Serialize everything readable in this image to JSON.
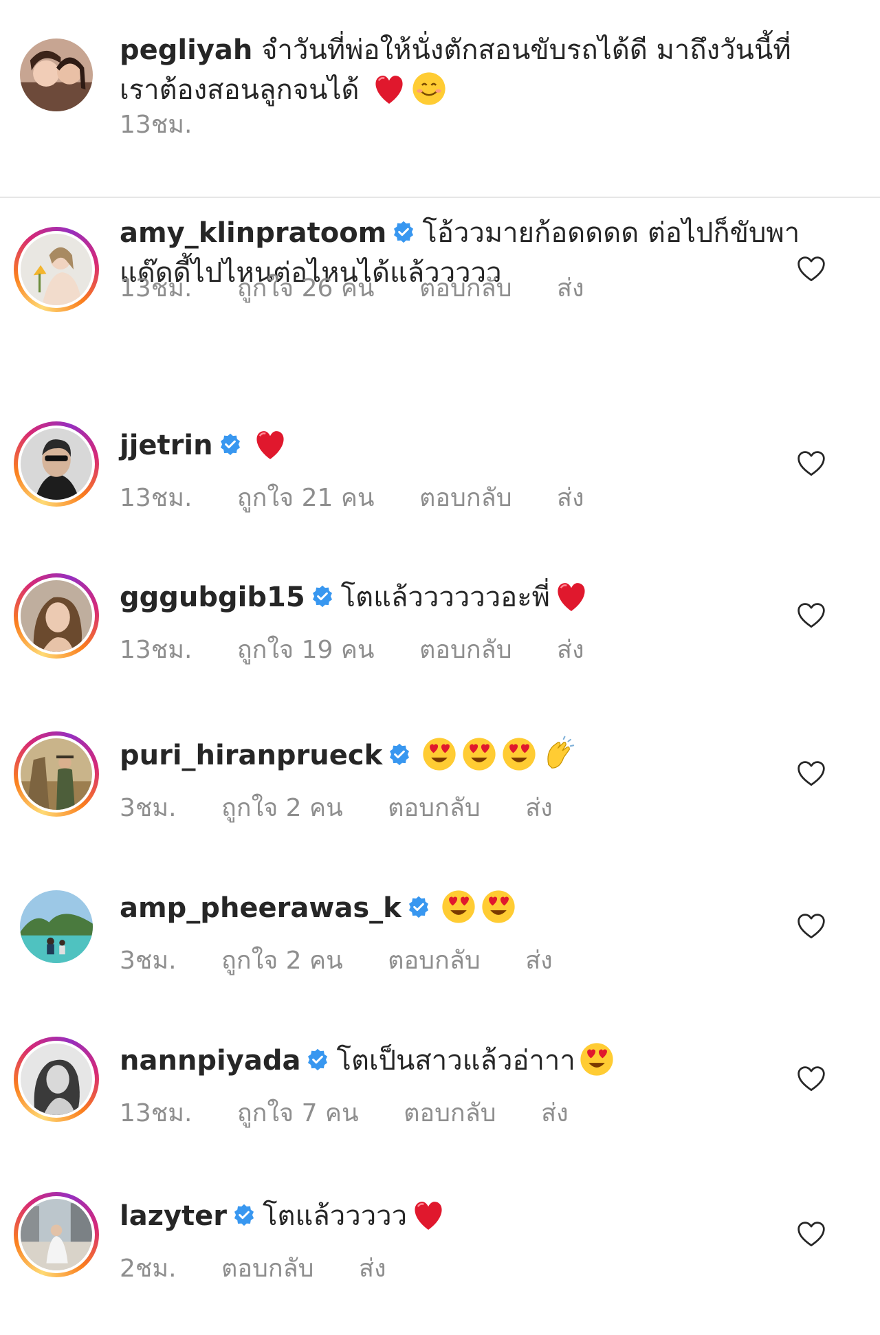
{
  "caption": {
    "username": "pegliyah",
    "text": "จำวันที่พ่อให้นั่งตักสอนขับรถได้ดี มาถึงวันนี้ที่เราต้องสอนลูกจนได้",
    "emojis": [
      "heart",
      "smile"
    ],
    "time": "13ชม."
  },
  "comments": [
    {
      "username": "amy_klinpratoom",
      "verified": true,
      "text": "โอ้ววมายก้อดดดด ต่อไปก็ขับพาแด๊ดดี้ไปไหนต่อไหนได้แล้ววววว",
      "emojis": [],
      "time": "13ชม.",
      "likes": "ถูกใจ 26 คน",
      "reply": "ตอบกลับ",
      "send": "ส่ง"
    },
    {
      "username": "jjetrin",
      "verified": true,
      "text": "",
      "emojis": [
        "heart"
      ],
      "time": "13ชม.",
      "likes": "ถูกใจ 21 คน",
      "reply": "ตอบกลับ",
      "send": "ส่ง"
    },
    {
      "username": "gggubgib15",
      "verified": true,
      "text": "โตแล้ววววววอะพี่",
      "emojis": [
        "heart"
      ],
      "time": "13ชม.",
      "likes": "ถูกใจ 19 คน",
      "reply": "ตอบกลับ",
      "send": "ส่ง"
    },
    {
      "username": "puri_hiranprueck",
      "verified": true,
      "text": "",
      "emojis": [
        "heart-eyes",
        "heart-eyes",
        "heart-eyes",
        "clap"
      ],
      "time": "3ชม.",
      "likes": "ถูกใจ 2 คน",
      "reply": "ตอบกลับ",
      "send": "ส่ง"
    },
    {
      "username": "amp_pheerawas_k",
      "verified": true,
      "text": "",
      "emojis": [
        "heart-eyes",
        "heart-eyes"
      ],
      "time": "3ชม.",
      "likes": "ถูกใจ 2 คน",
      "reply": "ตอบกลับ",
      "send": "ส่ง"
    },
    {
      "username": "nannpiyada",
      "verified": true,
      "text": "โตเป็นสาวแล้วอ่าาา",
      "emojis": [
        "heart-eyes"
      ],
      "time": "13ชม.",
      "likes": "ถูกใจ 7 คน",
      "reply": "ตอบกลับ",
      "send": "ส่ง"
    },
    {
      "username": "lazyter",
      "verified": true,
      "text": "โตแล้ววววว",
      "emojis": [
        "heart"
      ],
      "time": "2ชม.",
      "likes": "",
      "reply": "ตอบกลับ",
      "send": "ส่ง"
    }
  ],
  "icons": {
    "verified": "verified-badge-icon",
    "like": "heart-outline-icon"
  },
  "colors": {
    "text": "#262626",
    "meta": "#8e8e8e",
    "verified": "#3897f0",
    "divider": "#e6e6e6"
  }
}
